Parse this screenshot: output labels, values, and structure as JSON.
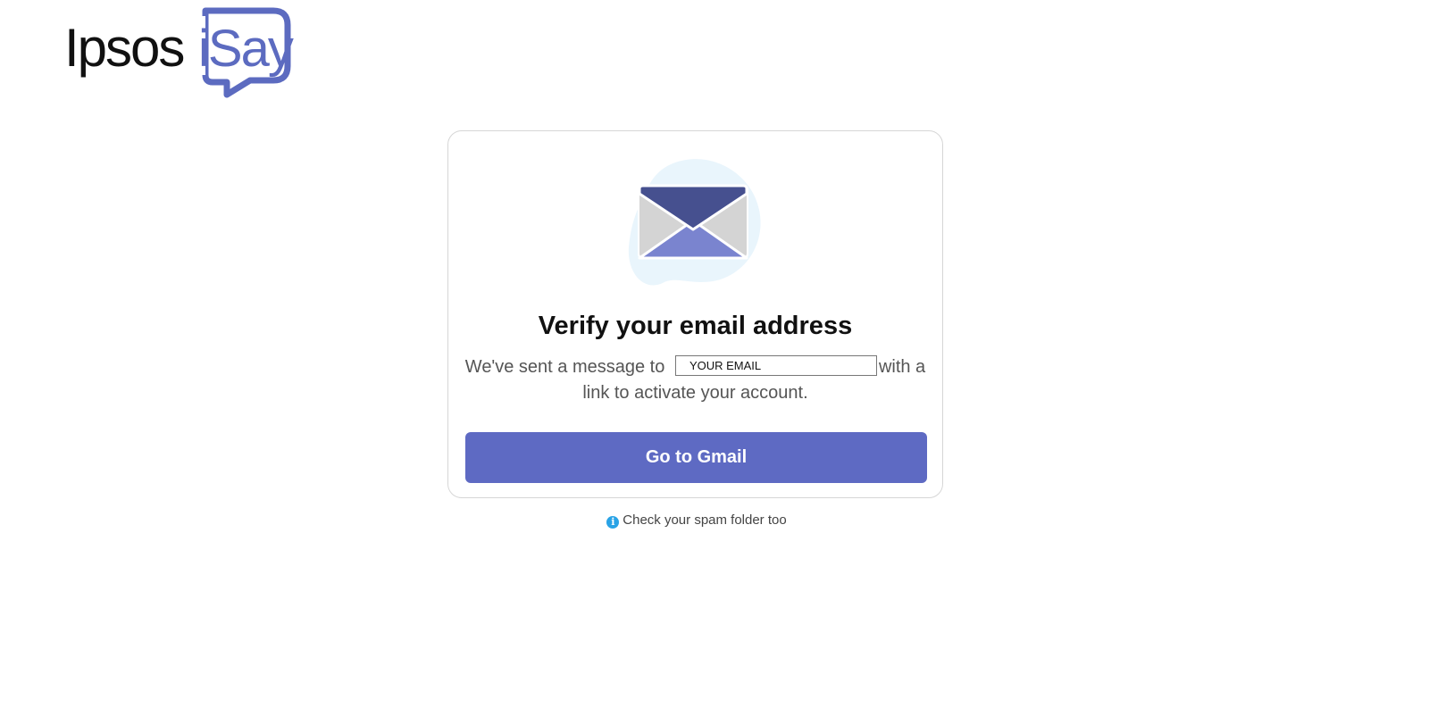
{
  "logo": {
    "brand": "Ipsos",
    "product": "iSay"
  },
  "card": {
    "title": "Verify your email address",
    "message_before": "We've sent a message to",
    "email_value": "YOUR EMAIL",
    "message_after": "with a link to activate your account.",
    "button_label": "Go to Gmail"
  },
  "hint": {
    "icon": "info-icon",
    "text": "Check your spam folder too"
  },
  "colors": {
    "accent": "#5e6ac3",
    "envelope_dark": "#46508f",
    "envelope_light": "#7a84cf",
    "info": "#29a3e6"
  }
}
